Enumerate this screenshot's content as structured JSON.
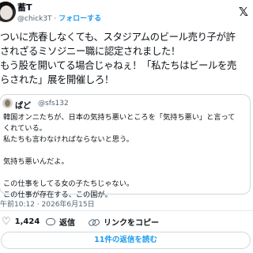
{
  "author": {
    "name": "蓄T",
    "handle": "@chick3T",
    "separator": " · ",
    "follow_label": "フォローする"
  },
  "tweet": {
    "text": "ついに売春しなくても、スタジアムのビール売り子が許\nされざるミソジニー職に認定されました！\nもう股を開いてる場合じゃねぇ！「私たちはビールを売\nらされた」展を開催しろ！",
    "timestamp": "午前10:12 · 2026年6月15日"
  },
  "quote": {
    "name": "ぱど",
    "handle": "@sfs132",
    "text": "韓国オンニたちが、日本の気持ち悪いところを「気持ち悪い」と言って\nくれている。\n私たちも言わなければならないと思う。\n\n気持ち悪いんだよ。\n\nこの仕事をしてる女の子たちじゃない。\nこの仕事が存在する、この国が。"
  },
  "actions": {
    "likes": "1,424",
    "reply_label": "返信",
    "copy_link_label": "リンクをコピー"
  },
  "more_replies_label": "11件の返信を読む",
  "icons": {
    "logo": "x-logo-icon",
    "like": "heart-icon",
    "reply": "reply-icon",
    "link": "link-icon"
  },
  "colors": {
    "accent": "#1d9bf0",
    "secondary_text": "#536471",
    "border": "#cfd9de"
  }
}
